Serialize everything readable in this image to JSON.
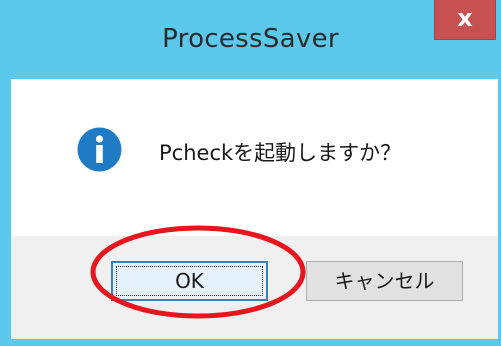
{
  "window": {
    "title": "ProcessSaver",
    "close_label": "x"
  },
  "dialog": {
    "message": "Pcheckを起動しますか？",
    "icon": "info-icon"
  },
  "buttons": {
    "ok_label": "OK",
    "cancel_label": "キャンセル"
  },
  "colors": {
    "titlebar": "#5bc8ec",
    "close_button": "#c75050",
    "info_icon": "#1f7cc4",
    "annotation_ring": "#e8141e"
  }
}
